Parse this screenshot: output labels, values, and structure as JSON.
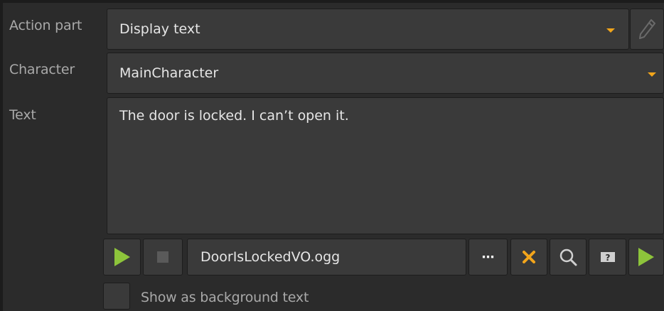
{
  "action_part": {
    "label": "Action part",
    "value": "Display text"
  },
  "character": {
    "label": "Character",
    "value": "MainCharacter"
  },
  "text": {
    "label": "Text",
    "value": "The door is locked. I can’t open it."
  },
  "voice": {
    "file": "DoorIsLockedVO.ogg",
    "browse_label": "⋯"
  },
  "background_option": {
    "label": "Show as background text",
    "checked": false
  },
  "icons": {
    "edit": "pencil-icon",
    "dropdown": "caret-down-icon",
    "play": "play-icon",
    "stop": "stop-icon",
    "clear": "close-icon",
    "search": "search-icon",
    "help": "help-icon"
  },
  "colors": {
    "accent_caret": "#f2a51b",
    "play_green": "#8dc43b",
    "clear_orange": "#f2a51b",
    "background": "#2b2b2b",
    "field": "#3a3a3a"
  }
}
